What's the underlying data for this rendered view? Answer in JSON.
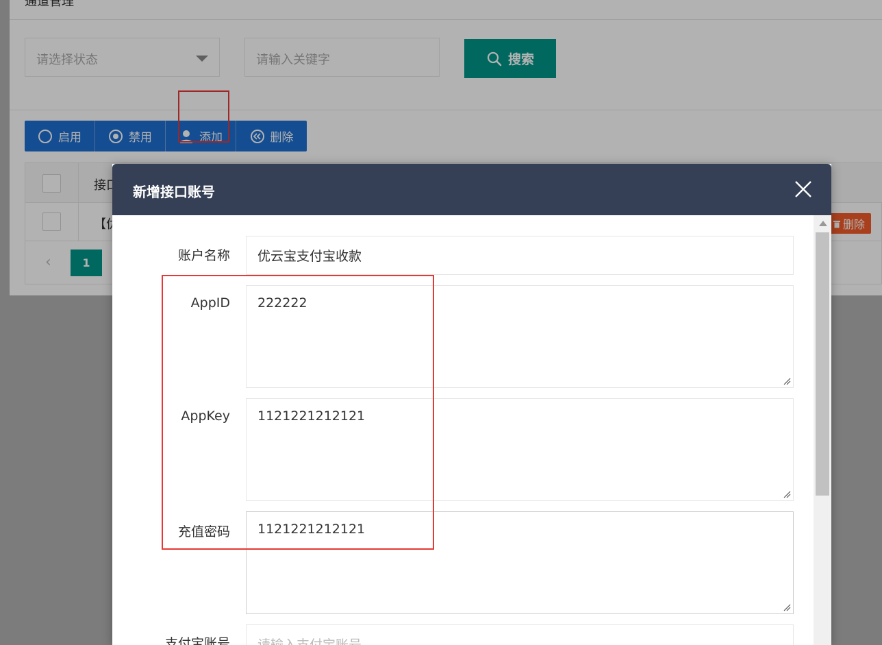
{
  "page": {
    "title": "通道管理"
  },
  "filters": {
    "status_placeholder": "请选择状态",
    "keyword_placeholder": "请输入关键字",
    "search_label": "搜索"
  },
  "toolbar": {
    "enable_label": "启用",
    "disable_label": "禁用",
    "add_label": "添加",
    "delete_label": "删除"
  },
  "table": {
    "header_text": "接口",
    "row_text": "【优",
    "row_delete_label": "删除"
  },
  "pagination": {
    "current_page": "1"
  },
  "modal": {
    "title": "新增接口账号",
    "fields": {
      "account_name": {
        "label": "账户名称",
        "value": "优云宝支付宝收款"
      },
      "app_id": {
        "label": "AppID",
        "value": "222222"
      },
      "app_key": {
        "label": "AppKey",
        "value": "1121221212121"
      },
      "recharge_password": {
        "label": "充值密码",
        "value": "1121221212121"
      },
      "alipay_account": {
        "label": "支付宝账号",
        "placeholder": "请输入支付宝账号"
      }
    }
  },
  "colors": {
    "primary": "#1e6fd0",
    "search": "#009688",
    "danger": "#f35c2a",
    "modal_header": "#353f55",
    "highlight": "#e53935"
  }
}
